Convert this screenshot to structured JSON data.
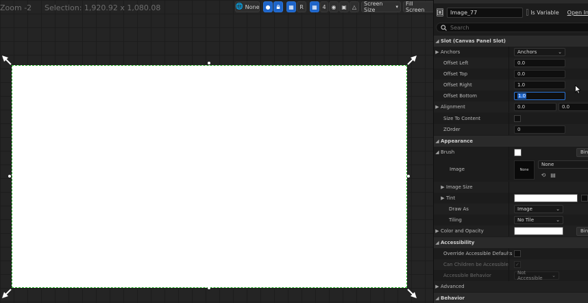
{
  "viewport": {
    "zoom": "Zoom -2",
    "selection": "Selection: 1,920.92 x 1,080.08",
    "toolbar": {
      "none_label": "None",
      "r_label": "R",
      "grid_value": "4",
      "screen_size": "Screen Size",
      "fill_screen": "Fill Screen"
    }
  },
  "details": {
    "widget_name": "Image_77",
    "is_variable_label": "Is Variable",
    "open_in_label": "Open In",
    "search_placeholder": "Search",
    "slot": {
      "header": "Slot (Canvas Panel Slot)",
      "anchors_label": "Anchors",
      "anchors_value": "Anchors",
      "offset_left_label": "Offset Left",
      "offset_left_value": "0.0",
      "offset_top_label": "Offset Top",
      "offset_top_value": "0.0",
      "offset_right_label": "Offset Right",
      "offset_right_value": "1.0",
      "offset_bottom_label": "Offset Bottom",
      "offset_bottom_value": "1.0",
      "alignment_label": "Alignment",
      "alignment_x": "0.0",
      "alignment_y": "0.0",
      "size_to_content_label": "Size To Content",
      "zorder_label": "ZOrder",
      "zorder_value": "0"
    },
    "appearance": {
      "header": "Appearance",
      "brush_label": "Brush",
      "bind_label": "Bind",
      "image_label": "Image",
      "image_thumb": "None",
      "image_value": "None",
      "image_size_label": "Image Size",
      "tint_label": "Tint",
      "draw_as_label": "Draw As",
      "draw_as_value": "Image",
      "tiling_label": "Tiling",
      "tiling_value": "No Tile",
      "color_opacity_label": "Color and Opacity",
      "bind_label_2": "Bind"
    },
    "accessibility": {
      "header": "Accessibility",
      "override_label": "Override Accessible Defaults",
      "children_label": "Can Children be Accessible",
      "behavior_label": "Accessible Behavior",
      "behavior_value": "Not Accessible"
    },
    "advanced_label": "Advanced",
    "behavior_header": "Behavior"
  },
  "colors": {
    "accent": "#1e64c8",
    "selection_outline": "#23b623",
    "canvas_fill": "#ffffff"
  }
}
